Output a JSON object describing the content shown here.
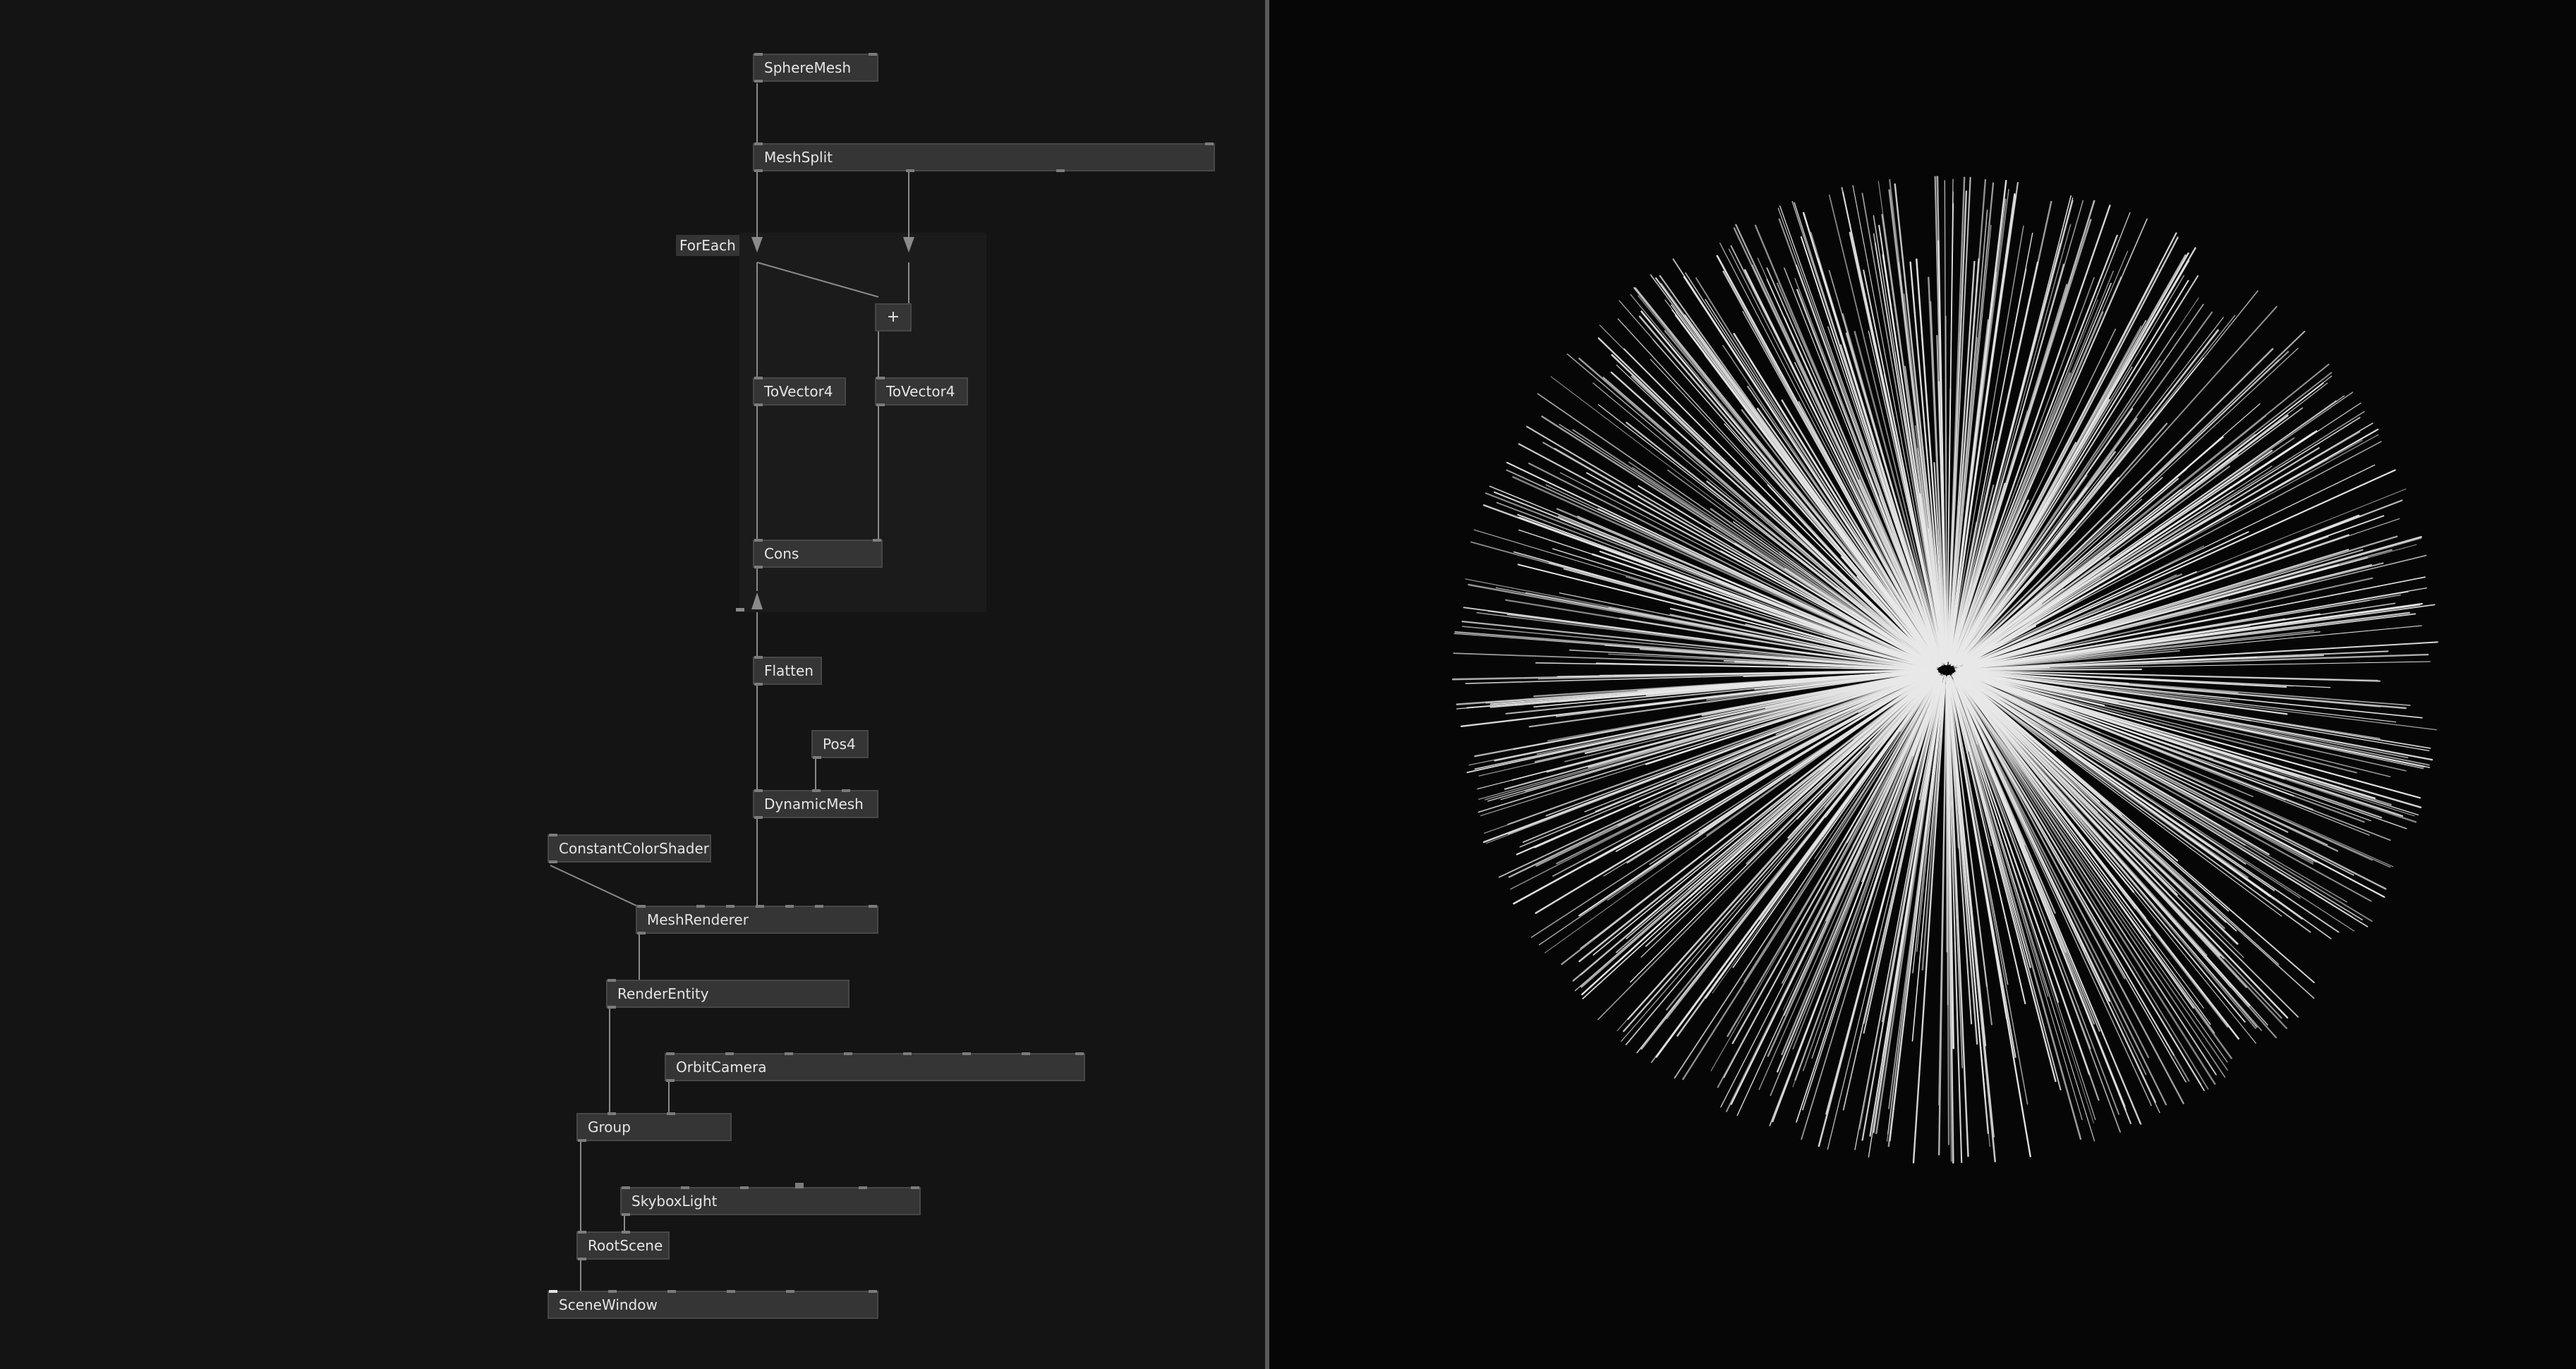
{
  "graph": {
    "nodes": [
      {
        "id": "spheremesh",
        "label": "SphereMesh"
      },
      {
        "id": "meshsplit",
        "label": "MeshSplit"
      },
      {
        "id": "plus",
        "label": "+"
      },
      {
        "id": "tovector4-a",
        "label": "ToVector4"
      },
      {
        "id": "tovector4-b",
        "label": "ToVector4"
      },
      {
        "id": "cons",
        "label": "Cons"
      },
      {
        "id": "flatten",
        "label": "Flatten"
      },
      {
        "id": "pos4",
        "label": "Pos4"
      },
      {
        "id": "dynamicmesh",
        "label": "DynamicMesh"
      },
      {
        "id": "constantcolorshader",
        "label": "ConstantColorShader"
      },
      {
        "id": "meshrenderer",
        "label": "MeshRenderer"
      },
      {
        "id": "renderentity",
        "label": "RenderEntity"
      },
      {
        "id": "orbitcamera",
        "label": "OrbitCamera"
      },
      {
        "id": "group",
        "label": "Group"
      },
      {
        "id": "skyboxlight",
        "label": "SkyboxLight"
      },
      {
        "id": "rootscene",
        "label": "RootScene"
      },
      {
        "id": "scenewindow",
        "label": "SceneWindow"
      }
    ],
    "subpatch_label": "ForEach"
  },
  "viewport": {
    "background": "#060606",
    "line_color": "#e8e8e8"
  },
  "colors": {
    "editor_bg": "#141414",
    "node_fill": "#353535",
    "wire": "#8a8a8a"
  }
}
